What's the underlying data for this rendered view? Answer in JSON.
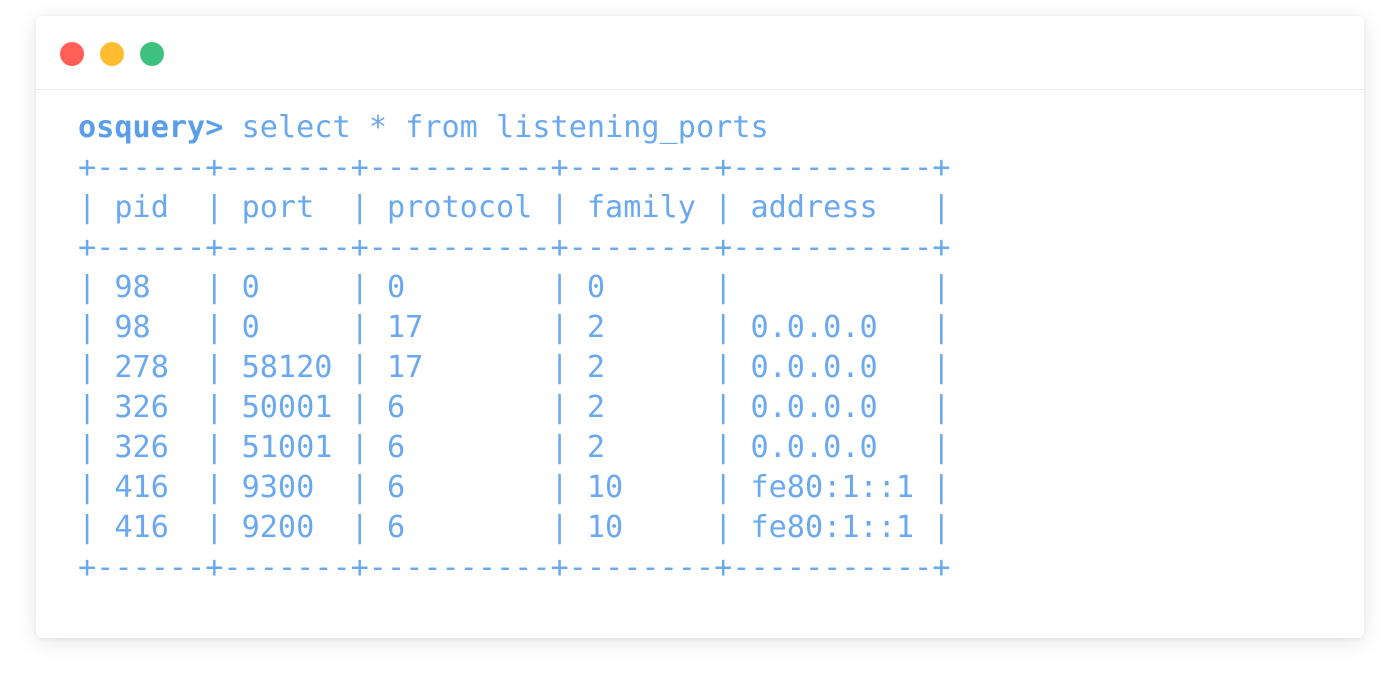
{
  "window": {
    "controls": {
      "close_color": "#ff5f57",
      "minimize_color": "#febc2e",
      "zoom_color": "#3ec07e"
    }
  },
  "terminal": {
    "prompt": "osquery>",
    "command": "select * from listening_ports",
    "text_color": "#6aa9ef",
    "border_line": "+------+-------+----------+--------+-----------+",
    "header_line": "| pid  | port  | protocol | family | address   |",
    "rows": [
      "| 98   | 0     | 0        | 0      |           |",
      "| 98   | 0     | 17       | 2      | 0.0.0.0   |",
      "| 278  | 58120 | 17       | 2      | 0.0.0.0   |",
      "| 326  | 50001 | 6        | 2      | 0.0.0.0   |",
      "| 326  | 51001 | 6        | 2      | 0.0.0.0   |",
      "| 416  | 9300  | 6        | 10     | fe80:1::1 |",
      "| 416  | 9200  | 6        | 10     | fe80:1::1 |"
    ]
  }
}
